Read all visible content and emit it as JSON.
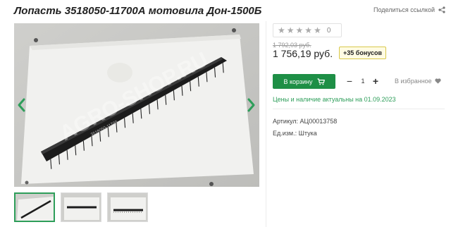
{
  "product": {
    "title": "Лопасть 3518050-11700А мотовила Дон-1500Б"
  },
  "share": {
    "label": "Поделиться ссылкой",
    "icon": "share-icon"
  },
  "gallery": {
    "watermark": "AGRO-SHOP.RU",
    "part_marking": "3518050-11700",
    "prev_icon": "chevron-left-icon",
    "next_icon": "chevron-right-icon",
    "thumbnails_count": 3,
    "active_thumbnail": 1
  },
  "rating": {
    "stars_filled": 0,
    "stars_total": 5,
    "count": "0"
  },
  "pricing": {
    "old_price": "1 792,03 руб.",
    "price": "1 756,19 руб.",
    "bonus": "+35 бонусов"
  },
  "cart": {
    "button_label": "В корзину",
    "minus": "−",
    "plus": "+",
    "quantity": "1"
  },
  "wishlist": {
    "label": "В избранное",
    "icon": "heart-icon"
  },
  "notice": "Цены и наличие актуальны на 01.09.2023",
  "attributes": {
    "article": "Артикул: АЦ00013758",
    "unit": "Ед.изм.: Штука"
  },
  "colors": {
    "accent_green": "#1e8f46",
    "notice_green": "#2e9e5a",
    "bonus_border": "#d8c84a"
  }
}
